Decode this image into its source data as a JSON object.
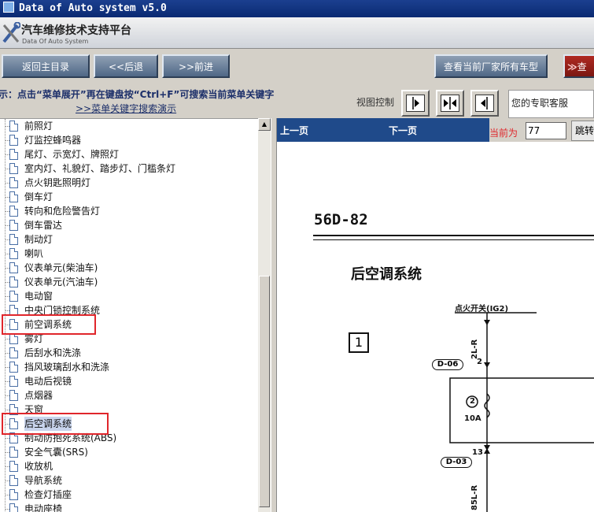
{
  "window": {
    "title": "Data of Auto system v5.0"
  },
  "brand": {
    "title_cn": "汽车维修技术支持平台",
    "title_en": "Data Of Auto System"
  },
  "toolbar": {
    "back_main": "返回主目录",
    "back": "<<后退",
    "forward": ">>前进",
    "view_all_models": "查看当前厂家所有车型",
    "search_partial": "查"
  },
  "hint": {
    "text": "提示：点击“菜单展开”再在键盘按“Ctrl+F”可搜索当前菜单关键字",
    "link": ">>菜单关键字搜索演示",
    "view_control": "视图控制",
    "agent": "您的专职客服"
  },
  "tree": {
    "items": [
      "前照灯",
      "灯监控蜂鸣器",
      "尾灯、示宽灯、牌照灯",
      "室内灯、礼貌灯、踏步灯、门槛条灯",
      "点火钥匙照明灯",
      "倒车灯",
      "转向和危险警告灯",
      "倒车雷达",
      "制动灯",
      "喇叭",
      "仪表单元(柴油车)",
      "仪表单元(汽油车)",
      "电动窗",
      "中央门锁控制系统",
      "前空调系统",
      "雾灯",
      "后刮水和洗涤",
      "挡风玻璃刮水和洗涤",
      "电动后视镜",
      "点烟器",
      "天窗",
      "后空调系统",
      "制动防抱死系统(ABS)",
      "安全气囊(SRS)",
      "收放机",
      "导航系统",
      "检查灯插座",
      "电动座椅"
    ],
    "highlighted": [
      "前空调系统",
      "后空调系统"
    ]
  },
  "viewer": {
    "prev": "上一页",
    "next": "下一页",
    "current_label": "当前为",
    "current_page": "77",
    "go": "跳转"
  },
  "document": {
    "page_code": "56D-82",
    "system_title": "后空调系统",
    "step": "1",
    "switch_label": "点火开关(IG2)",
    "wire1": "2L-R",
    "conn1": "D-06",
    "pin1": "2",
    "fuse_no": "2",
    "fuse_rating": "10A",
    "pin2": "13",
    "conn2": "D-03",
    "wire2": "85L-R"
  },
  "colors": {
    "highlight_box": "#e0262b",
    "viewer_header": "#1f4a8a",
    "button_blue": "#5b7391"
  }
}
